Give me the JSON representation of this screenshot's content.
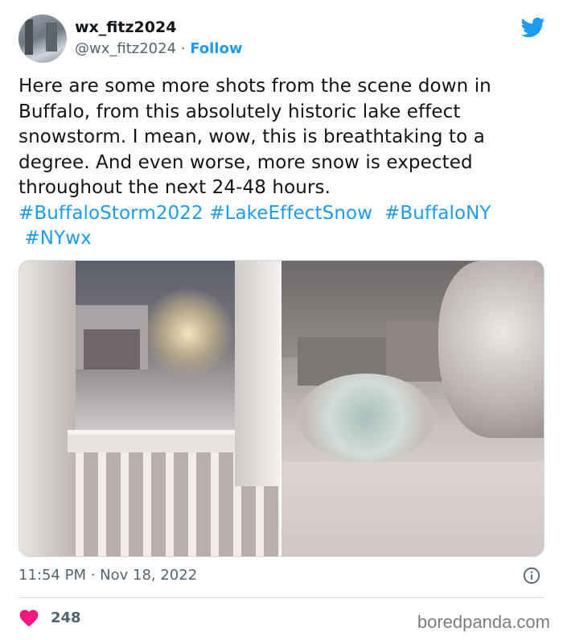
{
  "user": {
    "name": "wx_fitz2024",
    "handle": "@wx_fitz2024",
    "separator": " · ",
    "follow_label": "Follow"
  },
  "tweet": {
    "text": "Here are some more shots from the scene down in Buffalo, from this absolutely historic lake effect snowstorm. I mean, wow, this is breathtaking to a degree. And even worse, more snow is expected throughout the next 24-48 hours.",
    "hashtags": [
      "#BuffaloStorm2022",
      "#LakeEffectSnow",
      "#BuffaloNY",
      "#NYwx"
    ]
  },
  "media": {
    "photos": [
      "snowy-porch-street",
      "snowy-backyard-trees"
    ]
  },
  "meta": {
    "time": "11:54 PM",
    "separator": " · ",
    "date": "Nov 18, 2022"
  },
  "engagement": {
    "likes": "248"
  },
  "watermark": "boredpanda.com",
  "colors": {
    "accent": "#1d9bf0",
    "like": "#f91880",
    "secondary_text": "#536471"
  },
  "icons": [
    "twitter-bird-icon",
    "info-icon",
    "heart-icon"
  ]
}
